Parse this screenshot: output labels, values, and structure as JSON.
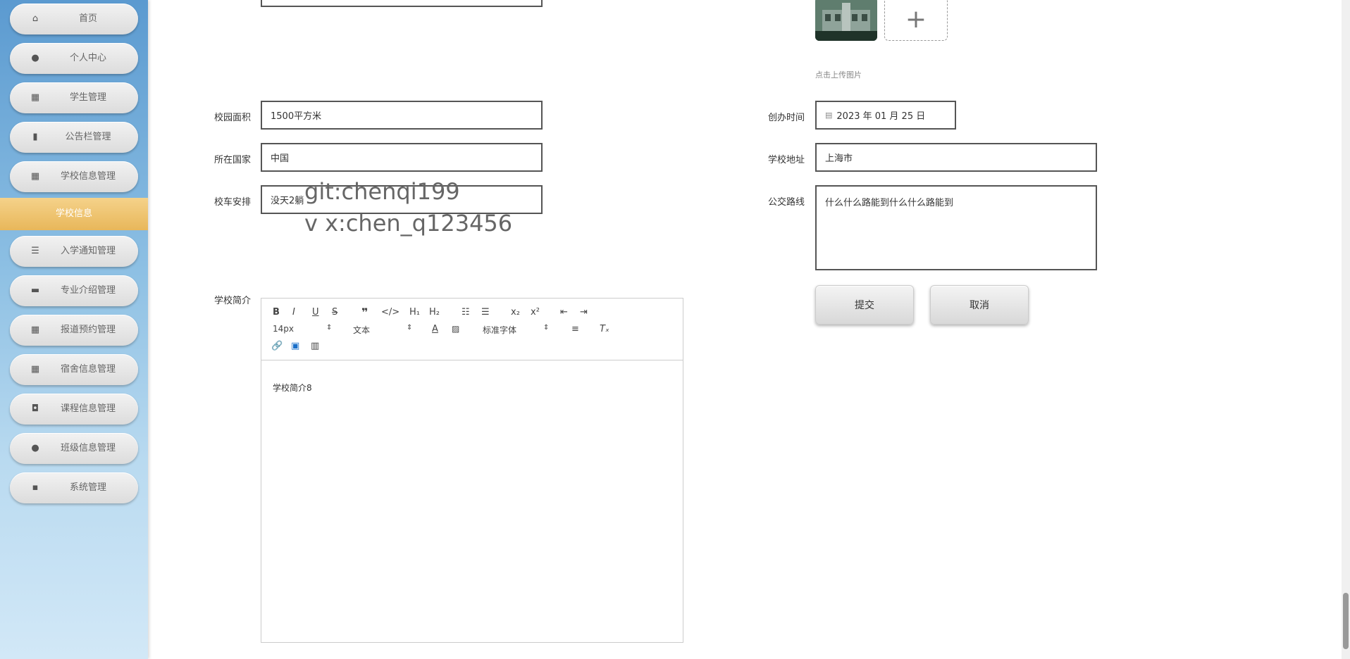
{
  "sidebar": {
    "items": [
      {
        "label": "首页",
        "icon": "home-icon"
      },
      {
        "label": "个人中心",
        "icon": "user-icon"
      },
      {
        "label": "学生管理",
        "icon": "grid-icon"
      },
      {
        "label": "公告栏管理",
        "icon": "book-icon"
      },
      {
        "label": "学校信息管理",
        "icon": "grid-icon"
      },
      {
        "label": "入学通知管理",
        "icon": "list-icon"
      },
      {
        "label": "专业介绍管理",
        "icon": "briefcase-icon"
      },
      {
        "label": "报道预约管理",
        "icon": "grid-icon"
      },
      {
        "label": "宿舍信息管理",
        "icon": "grid-icon"
      },
      {
        "label": "课程信息管理",
        "icon": "wallet-icon"
      },
      {
        "label": "班级信息管理",
        "icon": "bulb-icon"
      },
      {
        "label": "系统管理",
        "icon": "chat-icon"
      }
    ],
    "active_sub": "学校信息"
  },
  "form": {
    "upload_hint": "点击上传图片",
    "area_label": "校园面积",
    "area_value": "1500平方米",
    "country_label": "所在国家",
    "country_value": "中国",
    "bus_label": "校车安排",
    "bus_value": "没天2躺",
    "founded_label": "创办时间",
    "founded_value": "2023 年 01 月 25 日",
    "address_label": "学校地址",
    "address_value": "上海市",
    "route_label": "公交路线",
    "route_value": "什么什么路能到什么什么路能到",
    "intro_label": "学校简介",
    "intro_value": "学校简介8",
    "submit_label": "提交",
    "cancel_label": "取消"
  },
  "editor": {
    "font_size": "14px",
    "text_style": "文本",
    "font_family": "标准字体"
  },
  "watermark": {
    "line1": "git:chenqi199",
    "line2": "v x:chen_q123456"
  }
}
